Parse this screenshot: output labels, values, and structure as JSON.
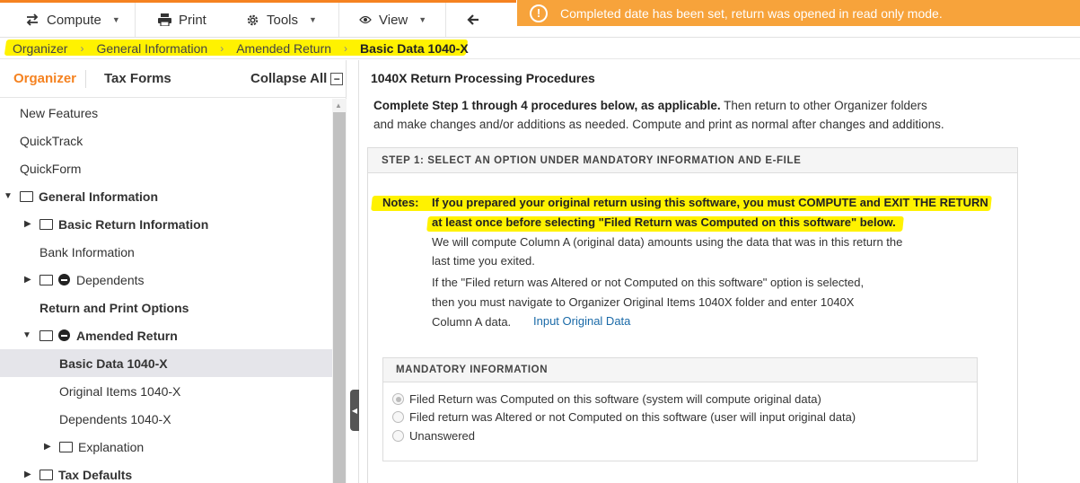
{
  "toolbar": {
    "compute_label": "Compute",
    "print_label": "Print",
    "tools_label": "Tools",
    "view_label": "View"
  },
  "notification": {
    "text": "Completed date has been set, return was opened in read only mode.",
    "color": "#f7a33b"
  },
  "breadcrumb": [
    "Organizer",
    "General Information",
    "Amended Return",
    "Basic Data 1040-X"
  ],
  "left_tabs": {
    "organizer": "Organizer",
    "tax_forms": "Tax Forms",
    "collapse_all": "Collapse All"
  },
  "tree": [
    {
      "label": "New Features"
    },
    {
      "label": "QuickTrack"
    },
    {
      "label": "QuickForm"
    },
    {
      "label": "General Information"
    },
    {
      "label": "Basic Return Information"
    },
    {
      "label": "Bank Information"
    },
    {
      "label": "Dependents"
    },
    {
      "label": "Return and Print Options"
    },
    {
      "label": "Amended Return"
    },
    {
      "label": "Basic Data 1040-X"
    },
    {
      "label": "Original Items 1040-X"
    },
    {
      "label": "Dependents 1040-X"
    },
    {
      "label": "Explanation"
    },
    {
      "label": "Tax Defaults"
    }
  ],
  "main": {
    "title": "1040X Return Processing Procedures",
    "intro_bold": "Complete Step 1 through 4 procedures below, as applicable.",
    "intro_rest1": "Then return to other Organizer folders",
    "intro_rest2": "and make changes and/or additions as needed. Compute and print as normal after changes and additions.",
    "step1_header": "STEP 1: SELECT AN OPTION UNDER MANDATORY INFORMATION AND E-FILE",
    "notes_label": "Notes:",
    "notes_line1": "If you prepared your original return using this software, you must COMPUTE and EXIT THE RETURN",
    "notes_line2": "at least once before selecting \"Filed Return was Computed on this software\" below.",
    "note_a1": "We will compute Column A (original data) amounts using the data that was in this return the",
    "note_a2": "last time you exited.",
    "note_b1": "If the \"Filed return was Altered or not Computed on this software\" option is selected,",
    "note_b2": "then you must navigate to Organizer Original Items 1040X folder and enter 1040X",
    "note_b3": "Column A data.",
    "input_link": "Input Original Data",
    "mandatory_header": "MANDATORY INFORMATION",
    "options": [
      "Filed Return was Computed on this software (system will compute original data)",
      "Filed return was Altered or not Computed on this software (user will input original data)",
      "Unanswered"
    ],
    "selected_option": 0
  },
  "colors": {
    "accent": "#f58220",
    "highlight": "#fff200",
    "link": "#1a6aa8"
  }
}
